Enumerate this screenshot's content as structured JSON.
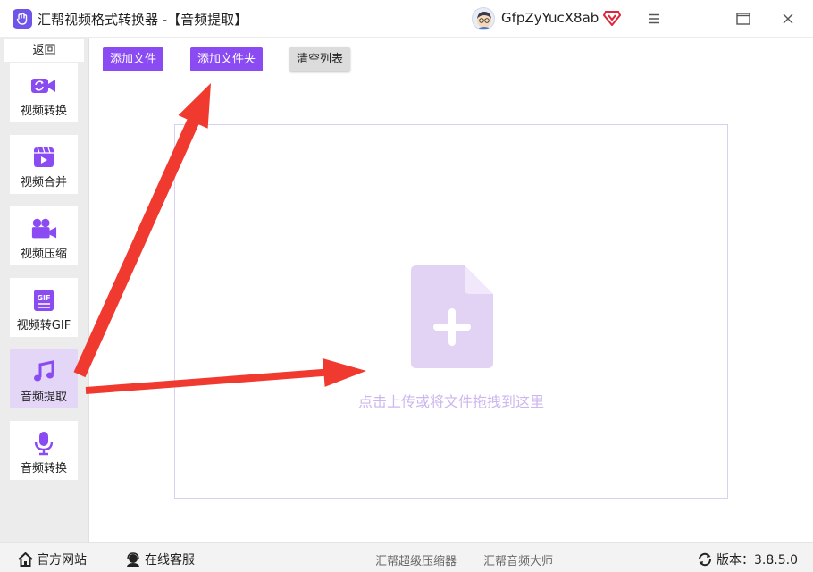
{
  "app": {
    "title": "汇帮视频格式转换器  -【音频提取】",
    "username": "GfpZyYucX8ab",
    "accent_color": "#8a4bf2"
  },
  "window_controls": {
    "menu_icon": "menu-icon",
    "maximize_icon": "maximize-icon",
    "close_icon": "close-icon"
  },
  "sidebar": {
    "back_label": "返回",
    "items": [
      {
        "label": "视频转换",
        "icon": "video-convert-icon"
      },
      {
        "label": "视频合并",
        "icon": "video-merge-icon"
      },
      {
        "label": "视频压缩",
        "icon": "video-compress-icon"
      },
      {
        "label": "视频转GIF",
        "icon": "gif-icon"
      },
      {
        "label": "音频提取",
        "icon": "music-note-icon",
        "active": true
      },
      {
        "label": "音频转换",
        "icon": "microphone-icon"
      }
    ]
  },
  "toolbar": {
    "add_file_label": "添加文件",
    "add_folder_label": "添加文件夹",
    "clear_list_label": "清空列表"
  },
  "dropzone": {
    "hint": "点击上传或将文件拖拽到这里",
    "icon": "file-add-icon"
  },
  "statusbar": {
    "website_label": "官方网站",
    "support_label": "在线客服",
    "compressor_label": "汇帮超级压缩器",
    "audio_master_label": "汇帮音频大师",
    "version_label": "版本：3.8.5.0"
  }
}
